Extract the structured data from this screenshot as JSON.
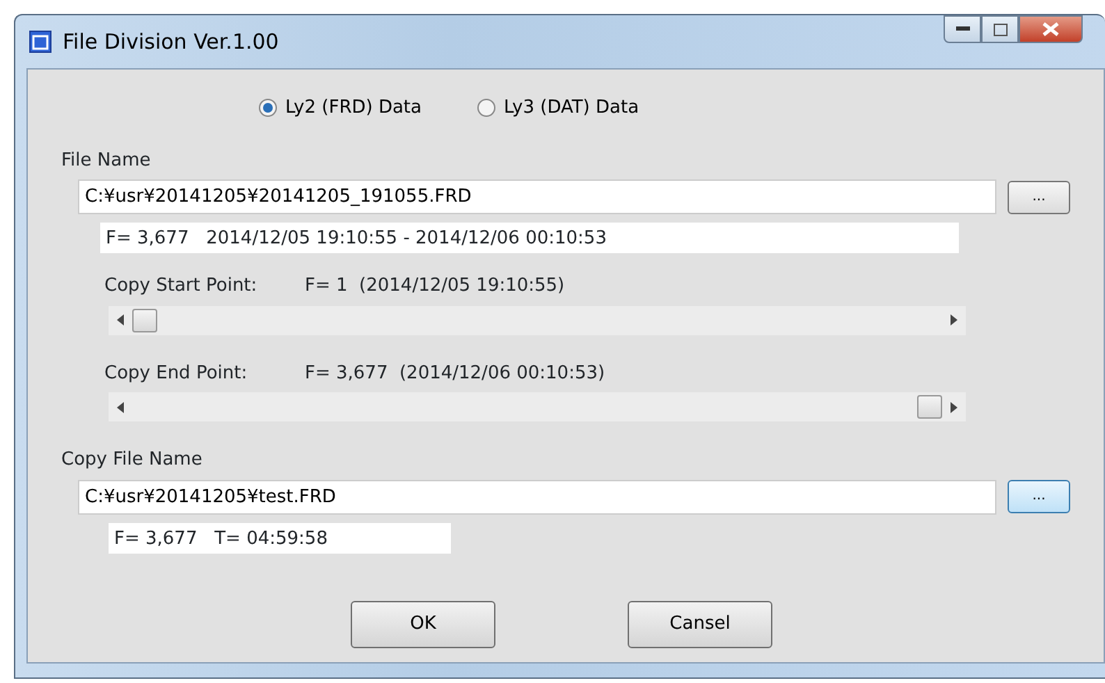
{
  "window": {
    "title": "File Division Ver.1.00"
  },
  "data_type": [
    {
      "label": "Ly2 (FRD) Data",
      "selected": true
    },
    {
      "label": "Ly3 (DAT) Data",
      "selected": false
    }
  ],
  "file_name": {
    "label": "File Name",
    "value": "C:¥usr¥20141205¥20141205_191055.FRD",
    "browse": "...",
    "info": "F= 3,677   2014/12/05 19:10:55 - 2014/12/06 00:10:53"
  },
  "copy_start": {
    "label": "Copy Start Point:",
    "value": "F= 1  (2014/12/05 19:10:55)",
    "level": 0
  },
  "copy_end": {
    "label": "Copy End Point:",
    "value": "F= 3,677  (2014/12/06 00:10:53)",
    "level": 1
  },
  "copy_file_name": {
    "label": "Copy File Name",
    "value": "C:¥usr¥20141205¥test.FRD",
    "browse": "...",
    "info": "F= 3,677   T= 04:59:58"
  },
  "buttons": [
    "OK",
    "Cansel"
  ]
}
